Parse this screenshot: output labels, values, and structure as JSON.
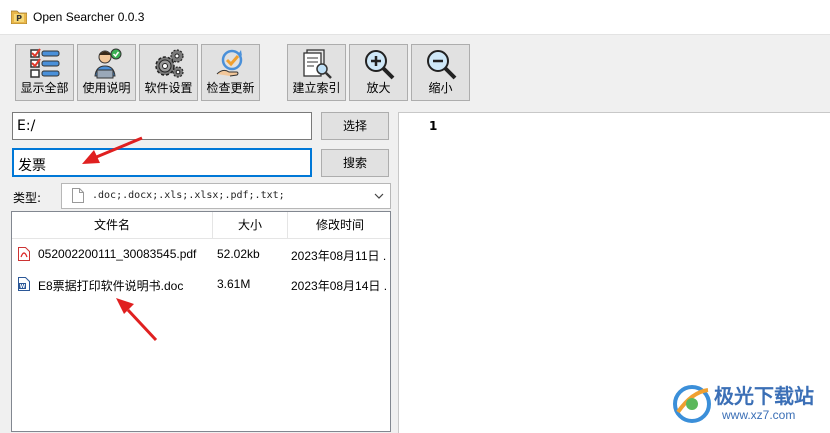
{
  "window": {
    "title": "Open Searcher 0.0.3"
  },
  "toolbar": {
    "show_all": "显示全部",
    "manual": "使用说明",
    "settings": "软件设置",
    "update": "检查更新",
    "build_index": "建立索引",
    "zoom_in": "放大",
    "zoom_out": "缩小"
  },
  "path": {
    "value": "E:/",
    "button": "选择"
  },
  "search": {
    "value": "发票",
    "button": "搜索"
  },
  "filetype": {
    "label": "类型:",
    "value": ".doc;.docx;.xls;.xlsx;.pdf;.txt;"
  },
  "results": {
    "columns": [
      "文件名",
      "大小",
      "修改时间"
    ],
    "rows": [
      {
        "icon": "pdf-file-icon",
        "name": "052002200111_30083545.pdf",
        "size": "52.02kb",
        "modified": "2023年08月11日 ."
      },
      {
        "icon": "word-file-icon",
        "name": "E8票据打印软件说明书.doc",
        "size": "3.61M",
        "modified": "2023年08月14日 ."
      }
    ]
  },
  "preview": {
    "line_number": "1"
  },
  "watermark": {
    "name": "极光下载站",
    "url": "www.xz7.com"
  },
  "colors": {
    "accent": "#0078d7",
    "annotation_arrow": "#e02020"
  }
}
